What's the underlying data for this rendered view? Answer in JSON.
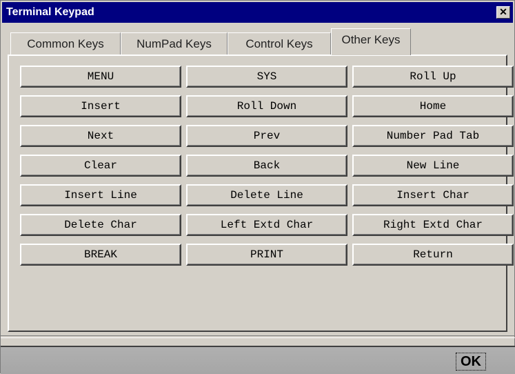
{
  "window": {
    "title": "Terminal Keypad",
    "close_label": "✕"
  },
  "tabs": [
    {
      "label": "Common Keys"
    },
    {
      "label": "NumPad Keys"
    },
    {
      "label": "Control Keys"
    },
    {
      "label": "Other Keys",
      "active": true
    }
  ],
  "keys": [
    [
      "MENU",
      "SYS",
      "Roll Up"
    ],
    [
      "Insert",
      "Roll Down",
      "Home"
    ],
    [
      "Next",
      "Prev",
      "Number Pad Tab"
    ],
    [
      "Clear",
      "Back",
      "New Line"
    ],
    [
      "Insert Line",
      "Delete Line",
      "Insert Char"
    ],
    [
      "Delete Char",
      "Left Extd Char",
      "Right Extd Char"
    ],
    [
      "BREAK",
      "PRINT",
      "Return"
    ]
  ],
  "footer": {
    "ok_label": "OK"
  }
}
